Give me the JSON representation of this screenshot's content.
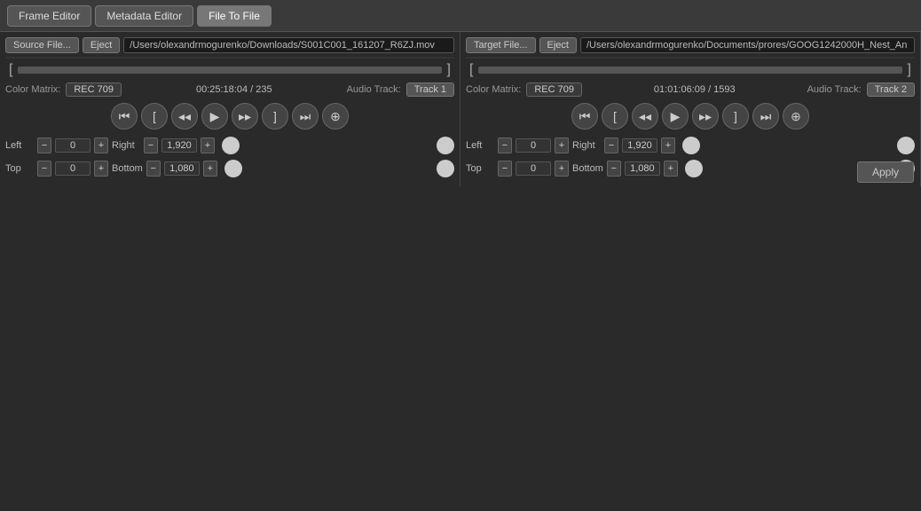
{
  "titlebar": {
    "buttons": [
      {
        "label": "Frame Editor",
        "active": false,
        "name": "frame-editor-tab"
      },
      {
        "label": "Metadata Editor",
        "active": false,
        "name": "metadata-editor-tab"
      },
      {
        "label": "File To File",
        "active": true,
        "name": "file-to-file-tab"
      }
    ]
  },
  "left_panel": {
    "source_btn": "Source File...",
    "eject_btn": "Eject",
    "file_path": "/Users/olexandrmogurenko/Downloads/S001C001_161207_R6ZJ.mov",
    "color_matrix_label": "Color Matrix:",
    "color_matrix_value": "REC 709",
    "timecode": "00:25:18:04 / 235",
    "audio_track_label": "Audio Track:",
    "audio_track_value": "Track 1",
    "left_label": "Left",
    "left_value": "0",
    "right_label": "Right",
    "right_value": "1,920",
    "top_label": "Top",
    "top_value": "0",
    "bottom_label": "Bottom",
    "bottom_value": "1,080"
  },
  "right_panel": {
    "target_btn": "Target File...",
    "eject_btn": "Eject",
    "file_path": "/Users/olexandrmogurenko/Documents/prores/GOOG1242000H_Nest_An",
    "color_matrix_label": "Color Matrix:",
    "color_matrix_value": "REC 709",
    "timecode": "01:01:06:09 / 1593",
    "audio_track_label": "Audio Track:",
    "audio_track_value": "Track 2",
    "left_label": "Left",
    "left_value": "0",
    "right_label": "Right",
    "right_value": "1,920",
    "top_label": "Top",
    "top_value": "0",
    "bottom_label": "Bottom",
    "bottom_value": "1,080"
  },
  "transport": {
    "rewind": "⏮",
    "bracket_left": "[",
    "prev_frame": "◂◂",
    "play": "▶",
    "next_frame": "▸▸",
    "bracket_right": "]",
    "skip": "⏭",
    "loop": "⊕"
  },
  "bottom": {
    "apply_label": "Apply"
  },
  "icons": {
    "minus": "−",
    "plus": "+"
  }
}
